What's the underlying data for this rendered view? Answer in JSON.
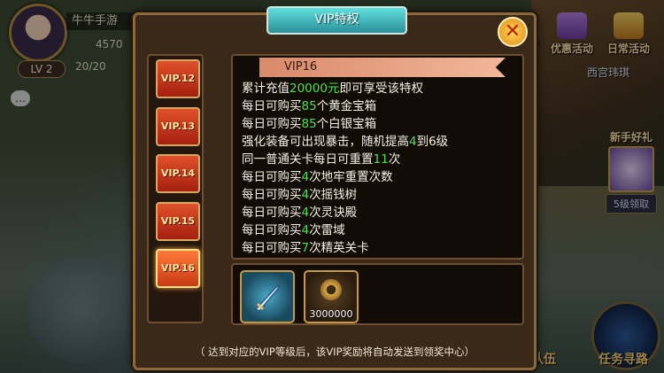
{
  "player": {
    "name": "牛牛手游",
    "power": "4570",
    "level": "LV  2",
    "stamina": "20/20"
  },
  "side_buttons": {
    "activity1": "动",
    "preferential": "优惠活动",
    "daily": "日常活动"
  },
  "npc_name": "西宫玮琪",
  "newbie": {
    "title": "新手好礼",
    "claim": "5级领取"
  },
  "bottom_buttons": {
    "team": "队伍",
    "quest": "任务寻路"
  },
  "dialog": {
    "title": "VIP特权",
    "close_symbol": "✕",
    "tabs": [
      "VIP.12",
      "VIP.13",
      "VIP.14",
      "VIP.15",
      "VIP.16"
    ],
    "active_tab": "VIP.16",
    "level_banner": "VIP16",
    "privileges": [
      {
        "pre": "累计充值",
        "hl": "20000元",
        "post": "即可享受该特权"
      },
      {
        "pre": "每日可购买",
        "hl": "85",
        "post": "个黄金宝箱"
      },
      {
        "pre": "每日可购买",
        "hl": "85",
        "post": "个白银宝箱"
      },
      {
        "pre": "强化装备可出现暴击，随机提高",
        "hl": "4",
        "post": "到6级"
      },
      {
        "pre": "同一普通关卡每日可重置",
        "hl": "11",
        "post": "次"
      },
      {
        "pre": "每日可购买",
        "hl": "4",
        "post": "次地牢重置次数"
      },
      {
        "pre": "每日可购买",
        "hl": "4",
        "post": "次摇钱树"
      },
      {
        "pre": "每日可购买",
        "hl": "4",
        "post": "次灵诀殿"
      },
      {
        "pre": "每日可购买",
        "hl": "4",
        "post": "次雷域"
      },
      {
        "pre": "每日可购买",
        "hl": "7",
        "post": "次精英关卡"
      }
    ],
    "rewards": [
      {
        "name": "sword",
        "count": ""
      },
      {
        "name": "coin",
        "count": "3000000"
      }
    ],
    "footer": "（ 达到对应的VIP等级后，该VIP奖励将自动发送到领奖中心）"
  },
  "colors": {
    "highlight": "#49e04c",
    "banner": "#2c8f99",
    "tab": "#c83a14"
  }
}
